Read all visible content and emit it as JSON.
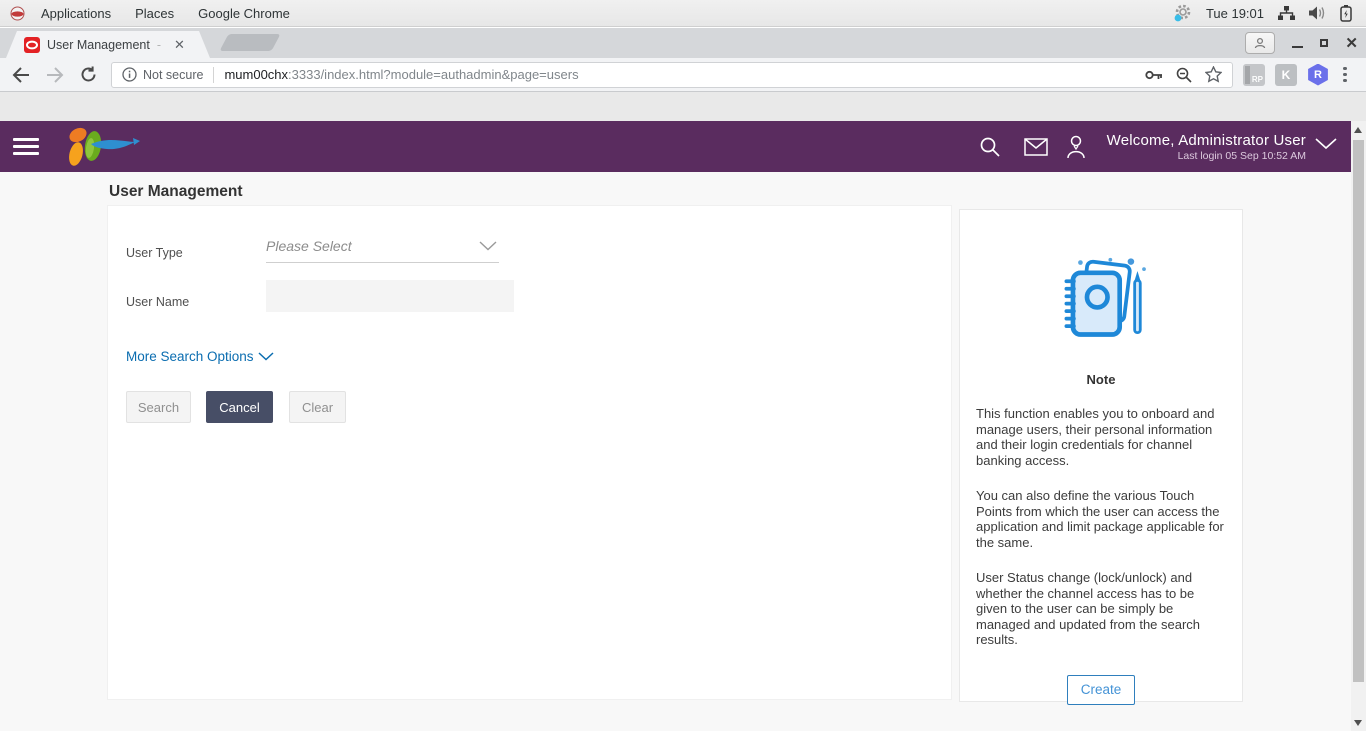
{
  "system_bar": {
    "menus": [
      {
        "label": "Applications"
      },
      {
        "label": "Places"
      },
      {
        "label": "Google Chrome"
      }
    ],
    "clock": "Tue 19:01"
  },
  "browser": {
    "tab_title": "User Management",
    "tab_title_suffix": "-",
    "url": {
      "security_label": "Not secure",
      "host": "mum00chx",
      "rest": ":3333/index.html?module=authadmin&page=users"
    },
    "extensions": {
      "rp": "RP",
      "k": "K",
      "r": "R"
    }
  },
  "app_header": {
    "welcome_text": "Welcome, Administrator User",
    "last_login": "Last login 05 Sep 10:52 AM"
  },
  "page": {
    "title": "User Management",
    "form": {
      "user_type_label": "User Type",
      "user_type_placeholder": "Please Select",
      "user_name_label": "User Name",
      "more_search_options": "More Search Options",
      "search_button": "Search",
      "cancel_button": "Cancel",
      "clear_button": "Clear"
    },
    "note": {
      "title": "Note",
      "paragraphs": [
        "This function enables you to onboard and manage users, their personal information and their login credentials for channel banking access.",
        "You can also define the various Touch Points from which the user can access the application and limit package applicable for the same.",
        "User Status change (lock/unlock) and whether the channel access has to be given to the user can be simply be managed and updated from the search results."
      ],
      "create_button": "Create"
    }
  },
  "colors": {
    "header_purple": "#5a2c5f",
    "accent_blue": "#0b6db0",
    "cancel_dark": "#474e66",
    "note_icon_blue": "#1e88d8"
  }
}
